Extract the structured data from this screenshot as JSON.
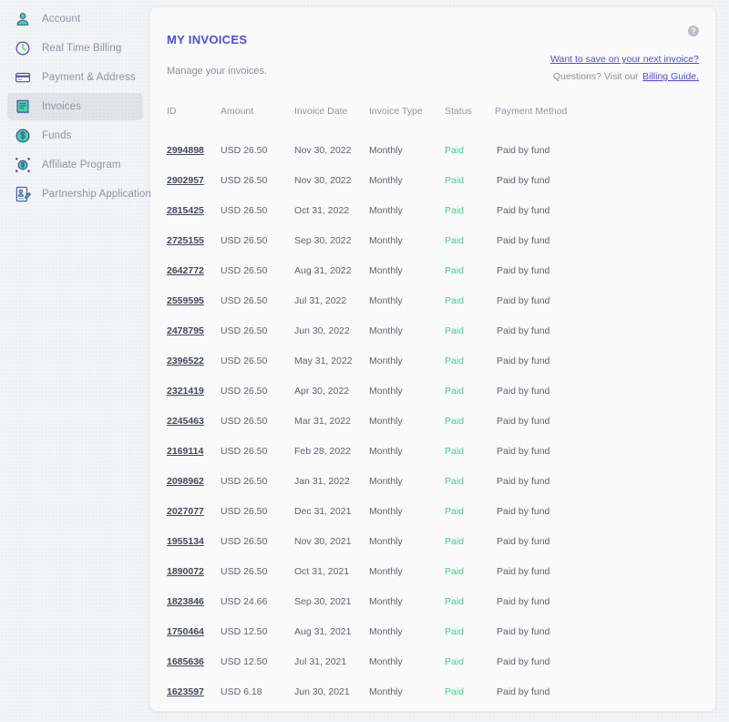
{
  "sidebar": {
    "items": [
      {
        "label": "Account",
        "icon": "user-icon",
        "active": false
      },
      {
        "label": "Real Time Billing",
        "icon": "clock-icon",
        "active": false
      },
      {
        "label": "Payment & Address",
        "icon": "credit-card-icon",
        "active": false
      },
      {
        "label": "Invoices",
        "icon": "invoice-icon",
        "active": true
      },
      {
        "label": "Funds",
        "icon": "dollar-circle-icon",
        "active": false
      },
      {
        "label": "Affiliate Program",
        "icon": "affiliate-icon",
        "active": false
      },
      {
        "label": "Partnership Application",
        "icon": "partnership-icon",
        "active": false
      }
    ]
  },
  "card": {
    "title": "MY INVOICES",
    "subtitle": "Manage your invoices.",
    "help_icon_label": "?",
    "links": {
      "save_link": "Want to save on your next invoice?",
      "questions_prefix": "Questions? Visit our",
      "billing_guide": "Billing Guide."
    }
  },
  "table": {
    "columns": [
      "ID",
      "Amount",
      "Invoice Date",
      "Invoice Type",
      "Status",
      "Payment Method"
    ],
    "rows": [
      {
        "id": "2994898",
        "amount": "USD 26.50",
        "date": "Nov 30, 2022",
        "type": "Monthly",
        "status": "Paid",
        "payment": "Paid by fund"
      },
      {
        "id": "2902957",
        "amount": "USD 26.50",
        "date": "Nov 30, 2022",
        "type": "Monthly",
        "status": "Paid",
        "payment": "Paid by fund"
      },
      {
        "id": "2815425",
        "amount": "USD 26.50",
        "date": "Oct 31, 2022",
        "type": "Monthly",
        "status": "Paid",
        "payment": "Paid by fund"
      },
      {
        "id": "2725155",
        "amount": "USD 26.50",
        "date": "Sep 30, 2022",
        "type": "Monthly",
        "status": "Paid",
        "payment": "Paid by fund"
      },
      {
        "id": "2642772",
        "amount": "USD 26.50",
        "date": "Aug 31, 2022",
        "type": "Monthly",
        "status": "Paid",
        "payment": "Paid by fund"
      },
      {
        "id": "2559595",
        "amount": "USD 26.50",
        "date": "Jul 31, 2022",
        "type": "Monthly",
        "status": "Paid",
        "payment": "Paid by fund"
      },
      {
        "id": "2478795",
        "amount": "USD 26.50",
        "date": "Jun 30, 2022",
        "type": "Monthly",
        "status": "Paid",
        "payment": "Paid by fund"
      },
      {
        "id": "2396522",
        "amount": "USD 26.50",
        "date": "May 31, 2022",
        "type": "Monthly",
        "status": "Paid",
        "payment": "Paid by fund"
      },
      {
        "id": "2321419",
        "amount": "USD 26.50",
        "date": "Apr 30, 2022",
        "type": "Monthly",
        "status": "Paid",
        "payment": "Paid by fund"
      },
      {
        "id": "2245463",
        "amount": "USD 26.50",
        "date": "Mar 31, 2022",
        "type": "Monthly",
        "status": "Paid",
        "payment": "Paid by fund"
      },
      {
        "id": "2169114",
        "amount": "USD 26.50",
        "date": "Feb 28, 2022",
        "type": "Monthly",
        "status": "Paid",
        "payment": "Paid by fund"
      },
      {
        "id": "2098962",
        "amount": "USD 26.50",
        "date": "Jan 31, 2022",
        "type": "Monthly",
        "status": "Paid",
        "payment": "Paid by fund"
      },
      {
        "id": "2027077",
        "amount": "USD 26.50",
        "date": "Dec 31, 2021",
        "type": "Monthly",
        "status": "Paid",
        "payment": "Paid by fund"
      },
      {
        "id": "1955134",
        "amount": "USD 26.50",
        "date": "Nov 30, 2021",
        "type": "Monthly",
        "status": "Paid",
        "payment": "Paid by fund"
      },
      {
        "id": "1890072",
        "amount": "USD 26.50",
        "date": "Oct 31, 2021",
        "type": "Monthly",
        "status": "Paid",
        "payment": "Paid by fund"
      },
      {
        "id": "1823846",
        "amount": "USD 24.66",
        "date": "Sep 30, 2021",
        "type": "Monthly",
        "status": "Paid",
        "payment": "Paid by fund"
      },
      {
        "id": "1750464",
        "amount": "USD 12.50",
        "date": "Aug 31, 2021",
        "type": "Monthly",
        "status": "Paid",
        "payment": "Paid by fund"
      },
      {
        "id": "1685636",
        "amount": "USD 12.50",
        "date": "Jul 31, 2021",
        "type": "Monthly",
        "status": "Paid",
        "payment": "Paid by fund"
      },
      {
        "id": "1623597",
        "amount": "USD 6.18",
        "date": "Jun 30, 2021",
        "type": "Monthly",
        "status": "Paid",
        "payment": "Paid by fund"
      }
    ]
  },
  "colors": {
    "accent": "#4b4ee0",
    "status_paid": "#41cf8e",
    "icon_primary": "#4b4fa8",
    "icon_accent": "#3fd99b",
    "page_bg": "#f2f4f6",
    "card_bg": "#fafafa"
  }
}
